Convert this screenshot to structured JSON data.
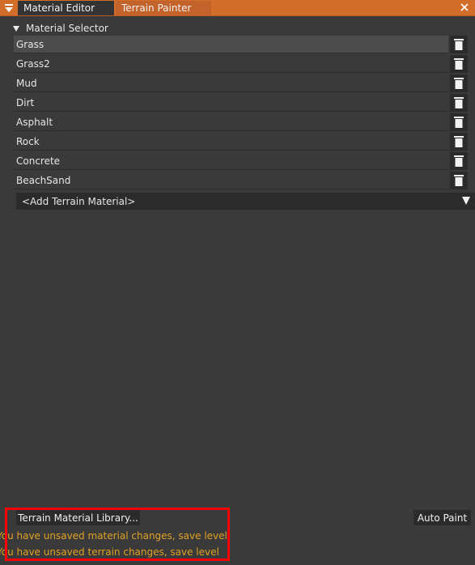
{
  "tabs": [
    {
      "label": "Material Editor"
    },
    {
      "label": "Terrain Painter"
    }
  ],
  "section": {
    "title": "Material Selector"
  },
  "materials": [
    {
      "name": "Grass"
    },
    {
      "name": "Grass2"
    },
    {
      "name": "Mud"
    },
    {
      "name": "Dirt"
    },
    {
      "name": "Asphalt"
    },
    {
      "name": "Rock"
    },
    {
      "name": "Concrete"
    },
    {
      "name": "BeachSand"
    }
  ],
  "add_material": {
    "label": "<Add Terrain Material>"
  },
  "footer": {
    "library_button": "Terrain Material Library...",
    "auto_paint_button": "Auto Paint",
    "warnings": [
      "You have unsaved material changes, save level",
      "You have unsaved terrain changes, save level"
    ]
  },
  "colors": {
    "accent": "#d36e2a",
    "warning": "#e0a224",
    "highlight": "#ff0000"
  }
}
